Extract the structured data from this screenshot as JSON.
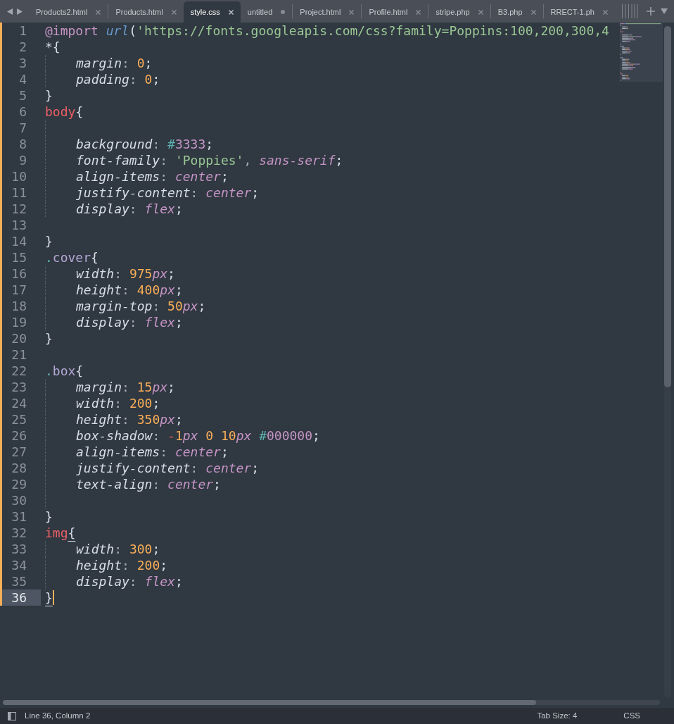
{
  "tabs": [
    {
      "label": "Products2.html",
      "selected": false,
      "dirty": false
    },
    {
      "label": "Products.html",
      "selected": false,
      "dirty": false
    },
    {
      "label": "style.css",
      "selected": true,
      "dirty": false
    },
    {
      "label": "untitled",
      "selected": false,
      "dirty": true
    },
    {
      "label": "Project.html",
      "selected": false,
      "dirty": false
    },
    {
      "label": "Profile.html",
      "selected": false,
      "dirty": false
    },
    {
      "label": "stripe.php",
      "selected": false,
      "dirty": false
    },
    {
      "label": "B3.php",
      "selected": false,
      "dirty": false
    },
    {
      "label": "RRECT-1.ph",
      "selected": false,
      "dirty": false
    }
  ],
  "lines": [
    {
      "number": "1",
      "indented": false,
      "modified": true,
      "current": false,
      "tokens": [
        {
          "kind": "at-rule",
          "text": "@import "
        },
        {
          "kind": "function",
          "text": "url"
        },
        {
          "kind": "punct",
          "text": "("
        },
        {
          "kind": "string",
          "text": "'https://fonts.googleapis.com/css?family=Poppins:100,200,300,4"
        }
      ]
    },
    {
      "number": "2",
      "indented": false,
      "modified": true,
      "current": false,
      "tokens": [
        {
          "kind": "universal",
          "text": "*"
        },
        {
          "kind": "punct",
          "text": "{"
        }
      ]
    },
    {
      "number": "3",
      "indented": true,
      "modified": true,
      "current": false,
      "tokens": [
        {
          "kind": "property",
          "text": "margin"
        },
        {
          "kind": "sep",
          "text": ": "
        },
        {
          "kind": "number",
          "text": "0"
        },
        {
          "kind": "punct",
          "text": ";"
        }
      ]
    },
    {
      "number": "4",
      "indented": true,
      "modified": true,
      "current": false,
      "tokens": [
        {
          "kind": "property",
          "text": "padding"
        },
        {
          "kind": "sep",
          "text": ": "
        },
        {
          "kind": "number",
          "text": "0"
        },
        {
          "kind": "punct",
          "text": ";"
        }
      ]
    },
    {
      "number": "5",
      "indented": false,
      "modified": true,
      "current": false,
      "tokens": [
        {
          "kind": "punct",
          "text": "}"
        }
      ]
    },
    {
      "number": "6",
      "indented": false,
      "modified": true,
      "current": false,
      "tokens": [
        {
          "kind": "selector-tag",
          "text": "body"
        },
        {
          "kind": "punct",
          "text": "{"
        }
      ]
    },
    {
      "number": "7",
      "indented": true,
      "modified": true,
      "current": false
    },
    {
      "number": "8",
      "indented": true,
      "modified": true,
      "current": false,
      "tokens": [
        {
          "kind": "property",
          "text": "background"
        },
        {
          "kind": "sep",
          "text": ": "
        },
        {
          "kind": "hash",
          "text": "#"
        },
        {
          "kind": "color",
          "text": "3333"
        },
        {
          "kind": "punct",
          "text": ";"
        }
      ]
    },
    {
      "number": "9",
      "indented": true,
      "modified": true,
      "current": false,
      "tokens": [
        {
          "kind": "property",
          "text": "font-family"
        },
        {
          "kind": "sep",
          "text": ": "
        },
        {
          "kind": "string",
          "text": "'Poppies'"
        },
        {
          "kind": "sep",
          "text": ", "
        },
        {
          "kind": "value",
          "text": "sans-serif"
        },
        {
          "kind": "punct",
          "text": ";"
        }
      ]
    },
    {
      "number": "10",
      "indented": true,
      "modified": true,
      "current": false,
      "tokens": [
        {
          "kind": "property",
          "text": "align-items"
        },
        {
          "kind": "sep",
          "text": ": "
        },
        {
          "kind": "value",
          "text": "center"
        },
        {
          "kind": "punct",
          "text": ";"
        }
      ]
    },
    {
      "number": "11",
      "indented": true,
      "modified": true,
      "current": false,
      "tokens": [
        {
          "kind": "property",
          "text": "justify-content"
        },
        {
          "kind": "sep",
          "text": ": "
        },
        {
          "kind": "value",
          "text": "center"
        },
        {
          "kind": "punct",
          "text": ";"
        }
      ]
    },
    {
      "number": "12",
      "indented": true,
      "modified": true,
      "current": false,
      "tokens": [
        {
          "kind": "property",
          "text": "display"
        },
        {
          "kind": "sep",
          "text": ": "
        },
        {
          "kind": "value",
          "text": "flex"
        },
        {
          "kind": "punct",
          "text": ";"
        }
      ]
    },
    {
      "number": "13",
      "indented": false,
      "modified": true,
      "current": false
    },
    {
      "number": "14",
      "indented": false,
      "modified": true,
      "current": false,
      "tokens": [
        {
          "kind": "punct",
          "text": "}"
        }
      ]
    },
    {
      "number": "15",
      "indented": false,
      "modified": true,
      "current": false,
      "tokens": [
        {
          "kind": "class-dot",
          "text": "."
        },
        {
          "kind": "selector-class",
          "text": "cover"
        },
        {
          "kind": "punct",
          "text": "{"
        }
      ]
    },
    {
      "number": "16",
      "indented": true,
      "modified": true,
      "current": false,
      "tokens": [
        {
          "kind": "property",
          "text": "width"
        },
        {
          "kind": "sep",
          "text": ": "
        },
        {
          "kind": "number",
          "text": "975"
        },
        {
          "kind": "unit",
          "text": "px"
        },
        {
          "kind": "punct",
          "text": ";"
        }
      ]
    },
    {
      "number": "17",
      "indented": true,
      "modified": true,
      "current": false,
      "tokens": [
        {
          "kind": "property",
          "text": "height"
        },
        {
          "kind": "sep",
          "text": ": "
        },
        {
          "kind": "number",
          "text": "400"
        },
        {
          "kind": "unit",
          "text": "px"
        },
        {
          "kind": "punct",
          "text": ";"
        }
      ]
    },
    {
      "number": "18",
      "indented": true,
      "modified": true,
      "current": false,
      "tokens": [
        {
          "kind": "property",
          "text": "margin-top"
        },
        {
          "kind": "sep",
          "text": ": "
        },
        {
          "kind": "number",
          "text": "50"
        },
        {
          "kind": "unit",
          "text": "px"
        },
        {
          "kind": "punct",
          "text": ";"
        }
      ]
    },
    {
      "number": "19",
      "indented": true,
      "modified": true,
      "current": false,
      "tokens": [
        {
          "kind": "property",
          "text": "display"
        },
        {
          "kind": "sep",
          "text": ": "
        },
        {
          "kind": "value",
          "text": "flex"
        },
        {
          "kind": "punct",
          "text": ";"
        }
      ]
    },
    {
      "number": "20",
      "indented": false,
      "modified": true,
      "current": false,
      "tokens": [
        {
          "kind": "punct",
          "text": "}"
        }
      ]
    },
    {
      "number": "21",
      "indented": false,
      "modified": true,
      "current": false
    },
    {
      "number": "22",
      "indented": false,
      "modified": true,
      "current": false,
      "tokens": [
        {
          "kind": "class-dot",
          "text": "."
        },
        {
          "kind": "selector-class",
          "text": "box"
        },
        {
          "kind": "punct",
          "text": "{"
        }
      ]
    },
    {
      "number": "23",
      "indented": true,
      "modified": true,
      "current": false,
      "tokens": [
        {
          "kind": "property",
          "text": "margin"
        },
        {
          "kind": "sep",
          "text": ": "
        },
        {
          "kind": "number",
          "text": "15"
        },
        {
          "kind": "unit",
          "text": "px"
        },
        {
          "kind": "punct",
          "text": ";"
        }
      ]
    },
    {
      "number": "24",
      "indented": true,
      "modified": true,
      "current": false,
      "tokens": [
        {
          "kind": "property",
          "text": "width"
        },
        {
          "kind": "sep",
          "text": ": "
        },
        {
          "kind": "number",
          "text": "200"
        },
        {
          "kind": "punct",
          "text": ";"
        }
      ]
    },
    {
      "number": "25",
      "indented": true,
      "modified": true,
      "current": false,
      "tokens": [
        {
          "kind": "property",
          "text": "height"
        },
        {
          "kind": "sep",
          "text": ": "
        },
        {
          "kind": "number",
          "text": "350"
        },
        {
          "kind": "unit",
          "text": "px"
        },
        {
          "kind": "punct",
          "text": ";"
        }
      ]
    },
    {
      "number": "26",
      "indented": true,
      "modified": true,
      "current": false,
      "tokens": [
        {
          "kind": "property",
          "text": "box-shadow"
        },
        {
          "kind": "sep",
          "text": ": "
        },
        {
          "kind": "operator",
          "text": "-"
        },
        {
          "kind": "number",
          "text": "1"
        },
        {
          "kind": "unit",
          "text": "px "
        },
        {
          "kind": "number",
          "text": "0 10"
        },
        {
          "kind": "unit",
          "text": "px "
        },
        {
          "kind": "hash",
          "text": "#"
        },
        {
          "kind": "color",
          "text": "000000"
        },
        {
          "kind": "punct",
          "text": ";"
        }
      ]
    },
    {
      "number": "27",
      "indented": true,
      "modified": true,
      "current": false,
      "tokens": [
        {
          "kind": "property",
          "text": "align-items"
        },
        {
          "kind": "sep",
          "text": ": "
        },
        {
          "kind": "value",
          "text": "center"
        },
        {
          "kind": "punct",
          "text": ";"
        }
      ]
    },
    {
      "number": "28",
      "indented": true,
      "modified": true,
      "current": false,
      "tokens": [
        {
          "kind": "property",
          "text": "justify-content"
        },
        {
          "kind": "sep",
          "text": ": "
        },
        {
          "kind": "value",
          "text": "center"
        },
        {
          "kind": "punct",
          "text": ";"
        }
      ]
    },
    {
      "number": "29",
      "indented": true,
      "modified": true,
      "current": false,
      "tokens": [
        {
          "kind": "property",
          "text": "text-align"
        },
        {
          "kind": "sep",
          "text": ": "
        },
        {
          "kind": "value",
          "text": "center"
        },
        {
          "kind": "punct",
          "text": ";"
        }
      ]
    },
    {
      "number": "30",
      "indented": true,
      "modified": true,
      "current": false
    },
    {
      "number": "31",
      "indented": false,
      "modified": true,
      "current": false,
      "tokens": [
        {
          "kind": "punct",
          "text": "}"
        }
      ]
    },
    {
      "number": "32",
      "indented": false,
      "modified": true,
      "current": false,
      "tokens": [
        {
          "kind": "selector-tag",
          "text": "img"
        },
        {
          "kind": "brace-match",
          "text": "{"
        }
      ]
    },
    {
      "number": "33",
      "indented": true,
      "modified": true,
      "current": false,
      "tokens": [
        {
          "kind": "property",
          "text": "width"
        },
        {
          "kind": "sep",
          "text": ": "
        },
        {
          "kind": "number",
          "text": "300"
        },
        {
          "kind": "punct",
          "text": ";"
        }
      ]
    },
    {
      "number": "34",
      "indented": true,
      "modified": true,
      "current": false,
      "tokens": [
        {
          "kind": "property",
          "text": "height"
        },
        {
          "kind": "sep",
          "text": ": "
        },
        {
          "kind": "number",
          "text": "200"
        },
        {
          "kind": "punct",
          "text": ";"
        }
      ]
    },
    {
      "number": "35",
      "indented": true,
      "modified": true,
      "current": false,
      "tokens": [
        {
          "kind": "property",
          "text": "display"
        },
        {
          "kind": "sep",
          "text": ": "
        },
        {
          "kind": "value",
          "text": "flex"
        },
        {
          "kind": "punct",
          "text": ";"
        }
      ]
    },
    {
      "number": "36",
      "indented": false,
      "modified": true,
      "current": true,
      "tokens": [
        {
          "kind": "brace-match",
          "text": "}"
        }
      ]
    }
  ],
  "status_bar": {
    "position": "Line 36, Column 2",
    "tab_size": "Tab Size: 4",
    "syntax": "CSS"
  }
}
